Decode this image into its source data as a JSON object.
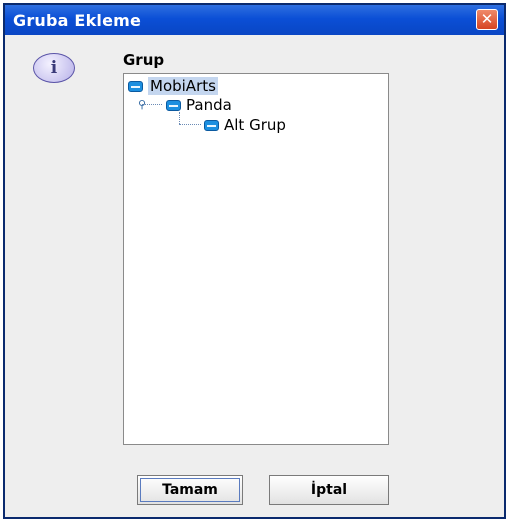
{
  "window": {
    "title": "Gruba Ekleme",
    "close_label": "✕"
  },
  "icons": {
    "info": "i"
  },
  "group": {
    "label": "Grup"
  },
  "tree": {
    "items": [
      {
        "label": "MobiArts",
        "level": 0,
        "selected": true
      },
      {
        "label": "Panda",
        "level": 1,
        "expanded": true
      },
      {
        "label": "Alt Grup",
        "level": 2
      }
    ]
  },
  "buttons": {
    "ok_label": "Tamam",
    "cancel_label": "İptal"
  },
  "colors": {
    "titlebar": "#0b4fd6",
    "folder_icon": "#1c8fe0",
    "selection": "#c4d6ef"
  }
}
